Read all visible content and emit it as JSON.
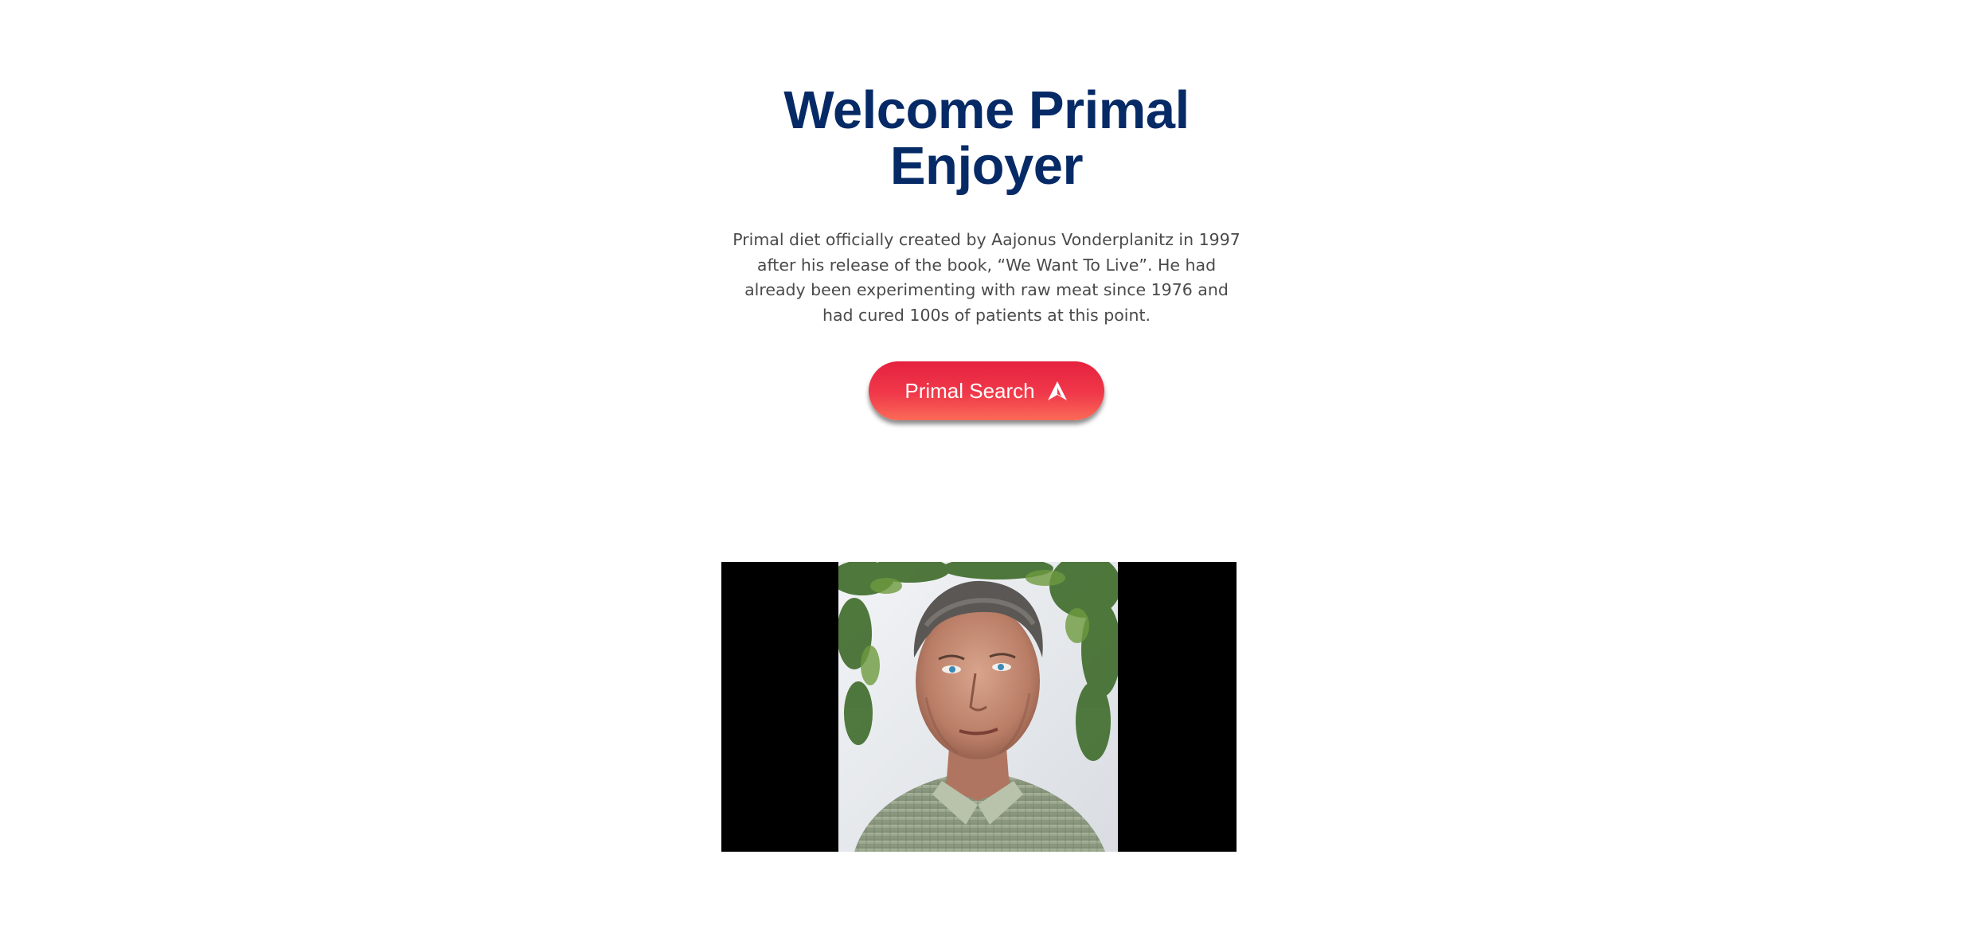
{
  "hero": {
    "title": "Welcome Primal Enjoyer",
    "description": "Primal diet officially created by Aajonus Vonderplanitz in 1997 after his release of the book, “We Want To Live”. He had already been experimenting with raw meat since 1976 and had cured 100s of patients at this point.",
    "cta_label": "Primal Search",
    "cta_icon": "navigation-arrow-icon"
  },
  "media": {
    "subject": "portrait-photo"
  },
  "colors": {
    "title": "#062a66",
    "text": "#4a4a4a",
    "cta_top": "#e6213f",
    "cta_bottom": "#fb6a57",
    "media_background": "#000000"
  }
}
